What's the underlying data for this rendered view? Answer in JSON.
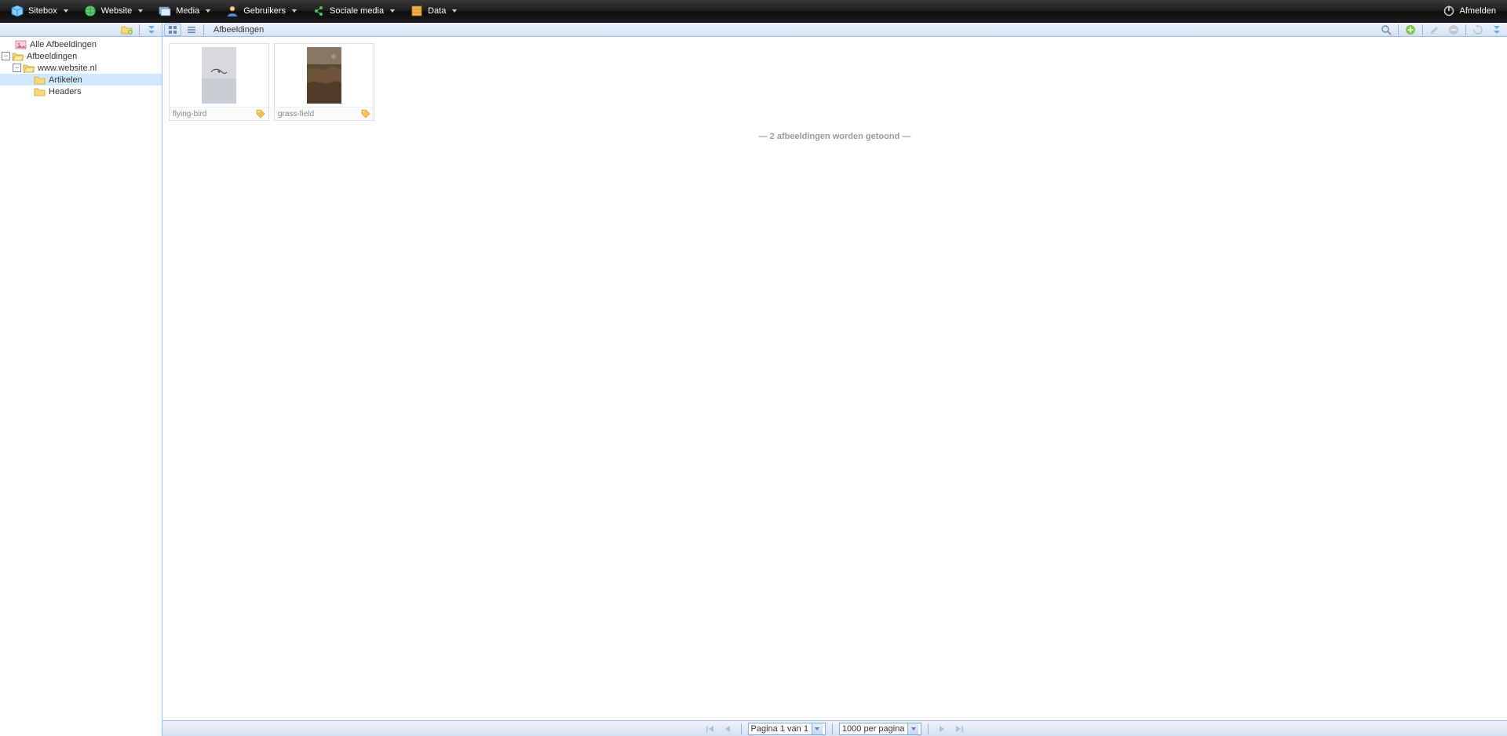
{
  "topmenu": {
    "items": [
      {
        "label": "Sitebox",
        "icon": "cube"
      },
      {
        "label": "Website",
        "icon": "globe"
      },
      {
        "label": "Media",
        "icon": "media"
      },
      {
        "label": "Gebruikers",
        "icon": "user"
      },
      {
        "label": "Sociale media",
        "icon": "social"
      },
      {
        "label": "Data",
        "icon": "data"
      }
    ],
    "logout": "Afmelden"
  },
  "tree": {
    "all_images": "Alle Afbeeldingen",
    "root": "Afbeeldingen",
    "site": "www.website.nl",
    "artikelen": "Artikelen",
    "headers": "Headers"
  },
  "content": {
    "breadcrumb": "Afbeeldingen",
    "items": [
      {
        "label": "flying-bird"
      },
      {
        "label": "grass-field"
      }
    ],
    "status": "— 2 afbeeldingen worden getoond —"
  },
  "pager": {
    "page_text": "Pagina 1 van 1",
    "per_page": "1000 per pagina"
  }
}
